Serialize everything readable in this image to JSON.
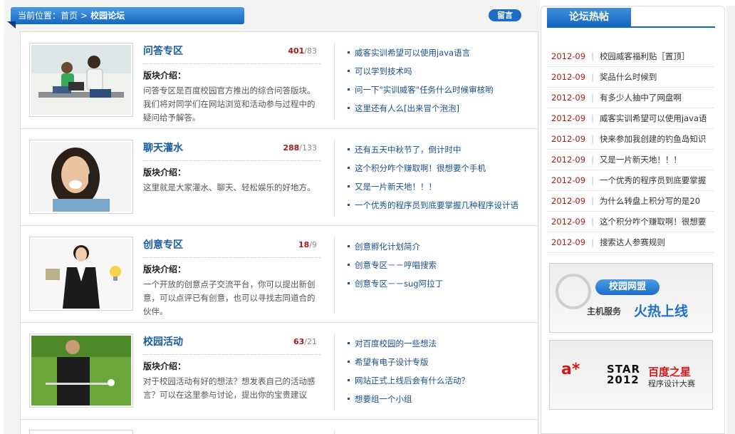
{
  "breadcrumb": {
    "prefix": "当前位置：",
    "home": "首页",
    "separator": ">",
    "current": "校园论坛"
  },
  "message_button": "留言",
  "forums": [
    {
      "title": "问答专区",
      "topics": "401",
      "posts": "/83",
      "intro_label": "版块介绍：",
      "description": "问答专区是百度校园官方推出的综合问答版块。我们将对同学们在网站浏览和活动参与过程中的疑问给予解答。",
      "links": [
        "威客实训希望可以使用java语言",
        "可以学到技术吗",
        "问一下\"实训威客\"任务什么时候审核哟",
        "这里还有人么[出来冒个泡泡]"
      ]
    },
    {
      "title": "聊天灌水",
      "topics": "288",
      "posts": "/133",
      "intro_label": "版块介绍：",
      "description": "这里就是大家灌水、聊天、轻松娱乐的好地方。",
      "links": [
        "还有五天中秋节了，倒计时中",
        "这个积分咋个赚取啊！很想要个手机",
        "又是一片新天地！！！",
        "一个优秀的程序员到底要掌握几种程序设计语"
      ]
    },
    {
      "title": "创意专区",
      "topics": "18",
      "posts": "/9",
      "intro_label": "版块介绍：",
      "description": "一个开放的创意点子交流平台，你可以提出新创意，可以点评已有创意，也可以寻找志同道合的伙伴。",
      "links": [
        "创意孵化计划简介",
        "创意专区－－哼唱搜索",
        "创意专区－－sug阿拉丁"
      ]
    },
    {
      "title": "校园活动",
      "topics": "63",
      "posts": "/21",
      "intro_label": "版块介绍：",
      "description": "对于校园活动有好的想法？想发表自己的活动感言？可以在这里参与讨论，提出你的宝贵建议",
      "links": [
        "对百度校园的一些想法",
        "希望有电子设计专版",
        "网站正式上线后会有什么活动？",
        "想要组一个小组"
      ]
    }
  ],
  "hot_posts": {
    "title": "论坛热帖",
    "items": [
      {
        "date": "2012-09",
        "title": "校园威客福利贴［置顶］"
      },
      {
        "date": "2012-09",
        "title": "奖品什么时候到"
      },
      {
        "date": "2012-09",
        "title": "有多少人抽中了网盘啊"
      },
      {
        "date": "2012-09",
        "title": "威客实训希望可以使用java语"
      },
      {
        "date": "2012-09",
        "title": "快来参加我创建的钓鱼岛知识"
      },
      {
        "date": "2012-09",
        "title": "又是一片新天地！！！"
      },
      {
        "date": "2012-09",
        "title": "一个优秀的程序员到底要掌握"
      },
      {
        "date": "2012-09",
        "title": "为什么转盘上积分写的是20"
      },
      {
        "date": "2012-09",
        "title": "这个积分咋个赚取啊！很想要"
      },
      {
        "date": "2012-09",
        "title": "搜索达人参赛规则"
      }
    ]
  },
  "ads": {
    "alliance": {
      "badge": "校园网盟",
      "service": "主机服务",
      "slogan": "火热上线"
    },
    "astar": {
      "brand": "a",
      "star_text": "STAR 2012",
      "title": "百度之星",
      "subtitle": "程序设计大赛"
    }
  }
}
